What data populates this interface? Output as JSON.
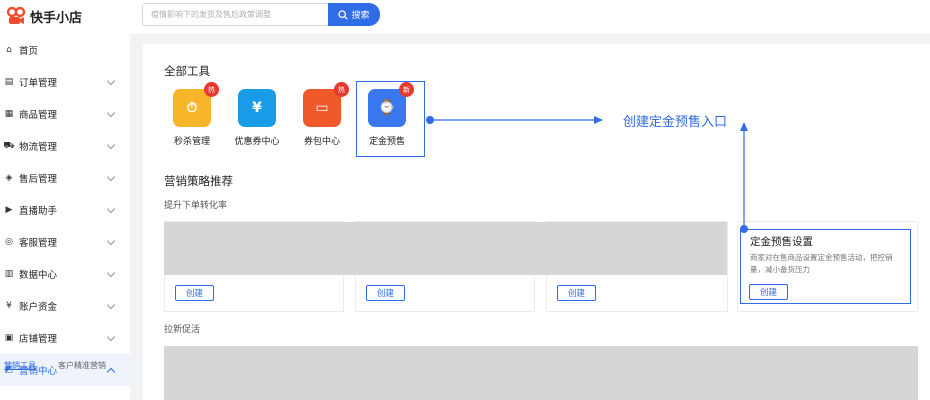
{
  "header": {
    "logo_text": "快手小店",
    "search_placeholder": "疫情影响下的发货及售后政策调整",
    "search_button": "搜索"
  },
  "sidebar": {
    "items": [
      {
        "label": "首页",
        "icon": "home-icon",
        "glyph": "⌂"
      },
      {
        "label": "订单管理",
        "icon": "order-icon",
        "glyph": "▤"
      },
      {
        "label": "商品管理",
        "icon": "product-icon",
        "glyph": "▦"
      },
      {
        "label": "物流管理",
        "icon": "truck-icon",
        "glyph": "⛟"
      },
      {
        "label": "售后管理",
        "icon": "shield-icon",
        "glyph": "◈"
      },
      {
        "label": "直播助手",
        "icon": "video-icon",
        "glyph": "▶"
      },
      {
        "label": "客服管理",
        "icon": "chat-icon",
        "glyph": "◎"
      },
      {
        "label": "数据中心",
        "icon": "chart-icon",
        "glyph": "▥"
      },
      {
        "label": "账户资金",
        "icon": "money-icon",
        "glyph": "¥"
      },
      {
        "label": "店铺管理",
        "icon": "store-icon",
        "glyph": "▣"
      },
      {
        "label": "营销中心",
        "icon": "marketing-icon",
        "glyph": "◩"
      }
    ],
    "sub_active": "营销工具",
    "sub_other": "客户精准营销"
  },
  "main": {
    "all_tools_title": "全部工具",
    "tools": [
      {
        "label": "秒杀管理",
        "badge": "热",
        "color": "#f7b529",
        "glyph": "⏱"
      },
      {
        "label": "优惠券中心",
        "badge": "",
        "color": "#1a9be8",
        "glyph": "¥"
      },
      {
        "label": "券包中心",
        "badge": "热",
        "color": "#f0592a",
        "glyph": "▭"
      },
      {
        "label": "定金预售",
        "badge": "新",
        "color": "#3a78f2",
        "glyph": "⌚"
      }
    ],
    "strategy_title": "营销策略推荐",
    "strategy_sub": "提升下单转化率",
    "create_label": "创建",
    "feature": {
      "title": "定金预售设置",
      "desc": "商家对在售商品设置定金预售活动，把控销量，减小备货压力",
      "button": "创建"
    },
    "pull_title": "拉新促活"
  },
  "annotation": "创建定金预售入口",
  "colors": {
    "accent": "#2f6ce5",
    "badge": "#e8392f",
    "placeholder": "#d6d6d6"
  }
}
